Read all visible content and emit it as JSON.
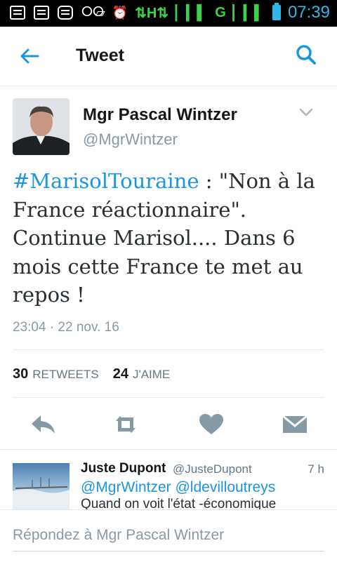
{
  "status_bar": {
    "time": "07:39",
    "network": "H",
    "network2": "G"
  },
  "app_bar": {
    "title": "Tweet"
  },
  "tweet": {
    "author_name": "Mgr Pascal Wintzer",
    "author_handle": "@MgrWintzer",
    "hashtag": "#MarisolTouraine",
    "text_rest": " : \"Non à la France réactionnaire\". Continue Marisol.... Dans 6 mois cette France te met au repos !",
    "timestamp": "23:04 · 22 nov. 16",
    "retweets_count": "30",
    "retweets_label": "RETWEETS",
    "likes_count": "24",
    "likes_label": "J'AIME"
  },
  "reply_preview": {
    "name": "Juste Dupont",
    "handle": "@JusteDupont",
    "time": "7 h",
    "mentions": "@MgrWintzer @ldevilloutreys",
    "text": "Quand on voit l'état -économique"
  },
  "composer": {
    "placeholder": "Répondez à Mgr Pascal Wintzer"
  },
  "colors": {
    "accent": "#1b95e0",
    "icon_gray": "#8899a6",
    "statusbar_bg": "#000000",
    "statusbar_time": "#33b5e5"
  }
}
